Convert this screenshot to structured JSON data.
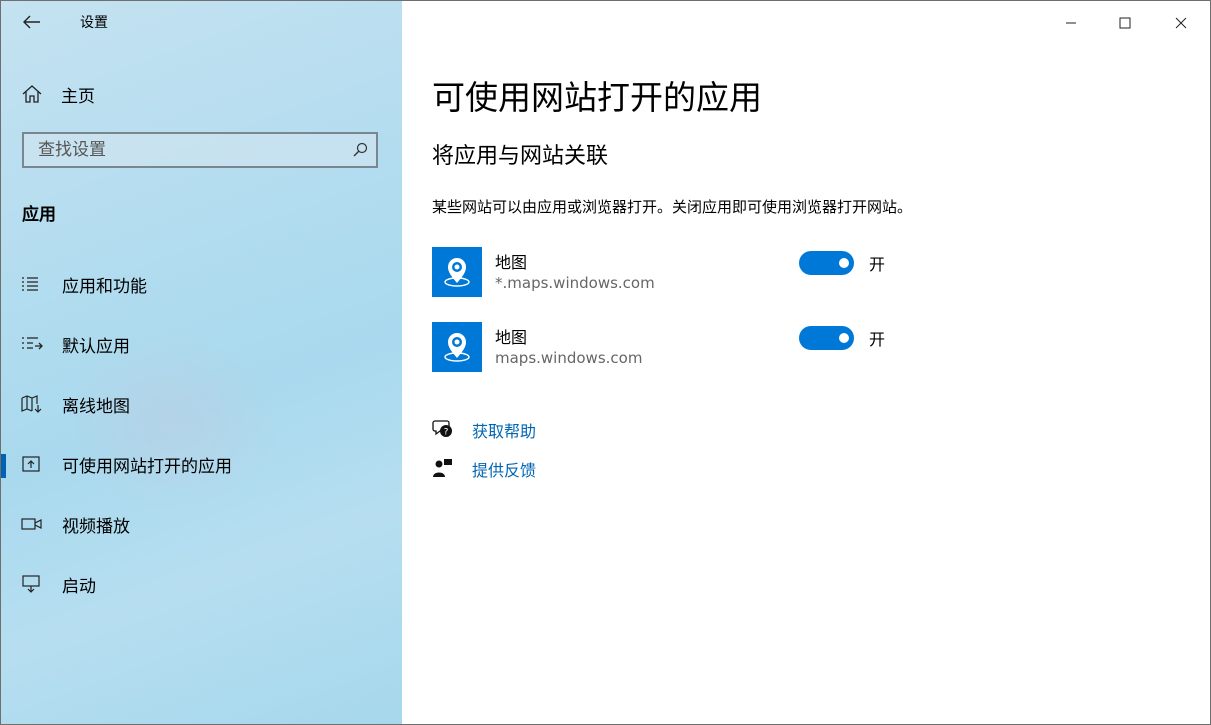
{
  "window": {
    "app_title": "设置"
  },
  "sidebar": {
    "home_label": "主页",
    "search_placeholder": "查找设置",
    "section_title": "应用",
    "items": [
      {
        "label": "应用和功能",
        "icon": "list-icon"
      },
      {
        "label": "默认应用",
        "icon": "default-apps-icon"
      },
      {
        "label": "离线地图",
        "icon": "map-download-icon"
      },
      {
        "label": "可使用网站打开的应用",
        "icon": "open-external-icon",
        "active": true
      },
      {
        "label": "视频播放",
        "icon": "video-icon"
      },
      {
        "label": "启动",
        "icon": "startup-icon"
      }
    ]
  },
  "main": {
    "title": "可使用网站打开的应用",
    "subtitle": "将应用与网站关联",
    "description": "某些网站可以由应用或浏览器打开。关闭应用即可使用浏览器打开网站。",
    "apps": [
      {
        "name": "地图",
        "site": "*.maps.windows.com",
        "toggle_label": "开",
        "enabled": true
      },
      {
        "name": "地图",
        "site": "maps.windows.com",
        "toggle_label": "开",
        "enabled": true
      }
    ],
    "links": [
      {
        "label": "获取帮助",
        "icon": "help-chat-icon"
      },
      {
        "label": "提供反馈",
        "icon": "feedback-icon"
      }
    ]
  },
  "colors": {
    "accent": "#0078d7",
    "link": "#0066b4",
    "active_indicator": "#0063b1"
  }
}
